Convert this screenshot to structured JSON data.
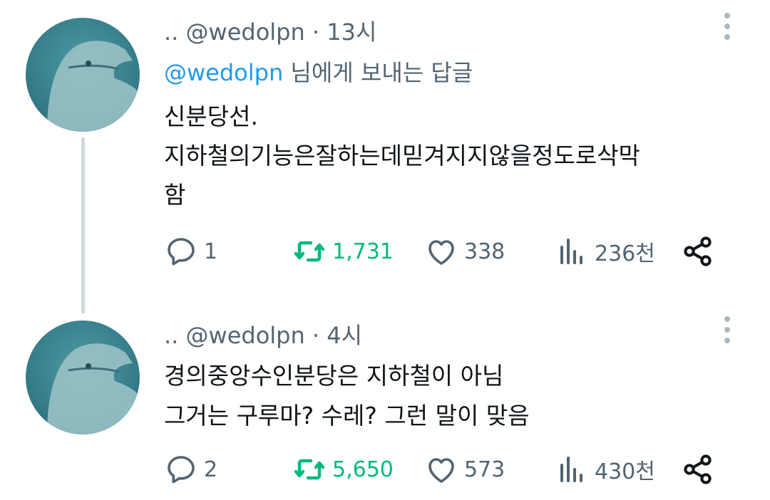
{
  "tweets": [
    {
      "display_name": "..",
      "handle": "@wedolpn",
      "separator": "·",
      "time": "13시",
      "reply_to_handle": "@wedolpn",
      "reply_to_suffix": "님에게 보내는 답글",
      "text": "신분당선.\n지하철의기능은잘하는데믿겨지지않을정도로삭막\n함",
      "replies": "1",
      "retweets": "1,731",
      "likes": "338",
      "views": "236천"
    },
    {
      "display_name": "..",
      "handle": "@wedolpn",
      "separator": "·",
      "time": "4시",
      "text": "경의중앙수인분당은 지하철이 아님\n그거는 구루마? 수레? 그런 말이 맞음",
      "replies": "2",
      "retweets": "5,650",
      "likes": "573",
      "views": "430천"
    }
  ],
  "icons": {
    "reply": "reply-icon",
    "retweet": "retweet-icon",
    "like": "heart-icon",
    "views": "views-icon",
    "share": "share-icon",
    "more": "more-vertical-icon"
  },
  "colors": {
    "text": "#0f1419",
    "muted": "#536471",
    "link": "#1d9bf0",
    "retweet_active": "#00ba7c",
    "thread_line": "#cfd9de"
  }
}
